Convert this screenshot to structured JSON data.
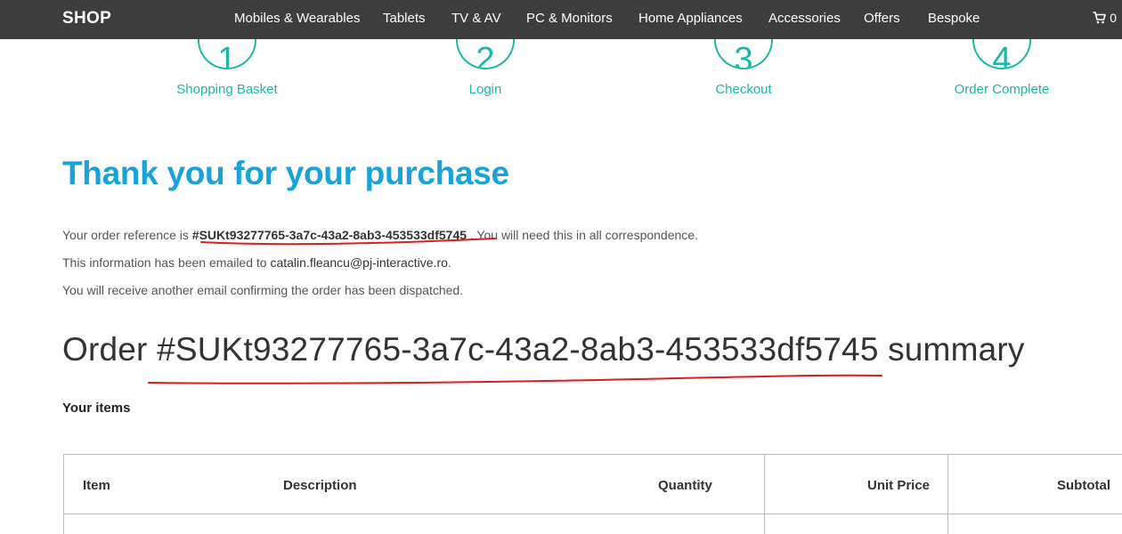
{
  "header": {
    "brand": "SHOP",
    "nav": [
      "Mobiles & Wearables",
      "Tablets",
      "TV & AV",
      "PC & Monitors",
      "Home Appliances",
      "Accessories",
      "Offers",
      "Bespoke"
    ],
    "cart_icon": "cart-icon",
    "cart_count": "0"
  },
  "steps": [
    {
      "number": "1",
      "label": "Shopping Basket"
    },
    {
      "number": "2",
      "label": "Login"
    },
    {
      "number": "3",
      "label": "Checkout"
    },
    {
      "number": "4",
      "label": "Order Complete"
    }
  ],
  "confirmation": {
    "title": "Thank you for your purchase",
    "ref_prefix": "Your order reference is",
    "ref_value": "#SUKt93277765-3a7c-43a2-8ab3-453533df5745",
    "ref_suffix": ". You will need this in all correspondence.",
    "email_prefix": "This information has been emailed to",
    "email_value": "catalin.fleancu@pj-interactive.ro",
    "email_suffix": ".",
    "dispatch_note": "You will receive another email confirming the order has been dispatched."
  },
  "summary": {
    "prefix": "Order",
    "order_id": "#SUKt93277765-3a7c-43a2-8ab3-453533df5745",
    "suffix": "summary",
    "items_label": "Your items"
  },
  "table": {
    "headers": [
      "Item",
      "Description",
      "Quantity",
      "Unit Price",
      "Subtotal"
    ]
  },
  "colors": {
    "accent_teal": "#1fb8a4",
    "title_blue": "#1aa3d9",
    "nav_bg": "#3d3d3d",
    "annotation_red": "#d9201c"
  }
}
